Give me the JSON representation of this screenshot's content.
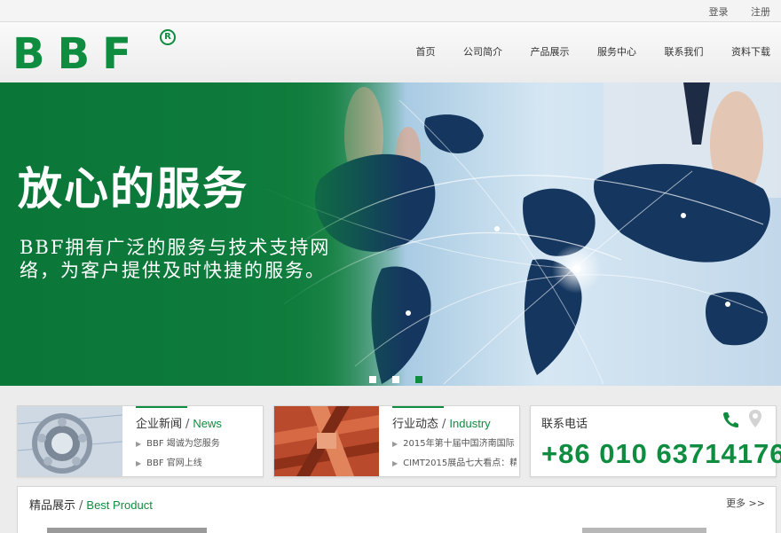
{
  "topbar": {
    "login": "登录",
    "register": "注册"
  },
  "logo": {
    "text": "BBF",
    "reg": "R"
  },
  "nav": [
    "首页",
    "公司简介",
    "产品展示",
    "服务中心",
    "联系我们",
    "资料下载"
  ],
  "hero": {
    "title": "放心的服务",
    "text": "BBF拥有广泛的服务与技术支持网络，为客户提供及时快捷的服务。",
    "slides": 3,
    "active_slide": 3
  },
  "news": {
    "title_cn": "企业新闻",
    "sep": "/",
    "title_en": "News",
    "items": [
      "BBF 竭诚为您服务",
      "BBF 官网上线"
    ]
  },
  "industry": {
    "title_cn": "行业动态",
    "sep": "/",
    "title_en": "Industry",
    "items": [
      "2015年第十届中国济南国际",
      "CIMT2015展品七大看点：精"
    ]
  },
  "contact": {
    "label": "联系电话",
    "phone": "+86 010 63714176"
  },
  "products": {
    "title_cn": "精品展示",
    "sep": "/",
    "title_en": "Best Product",
    "more": "更多 >>"
  },
  "colors": {
    "brand_green": "#0e8c3f",
    "hero_green": "#0c7a3c"
  },
  "icons": [
    "phone-icon",
    "location-pin-icon",
    "bullet-arrow-icon"
  ]
}
